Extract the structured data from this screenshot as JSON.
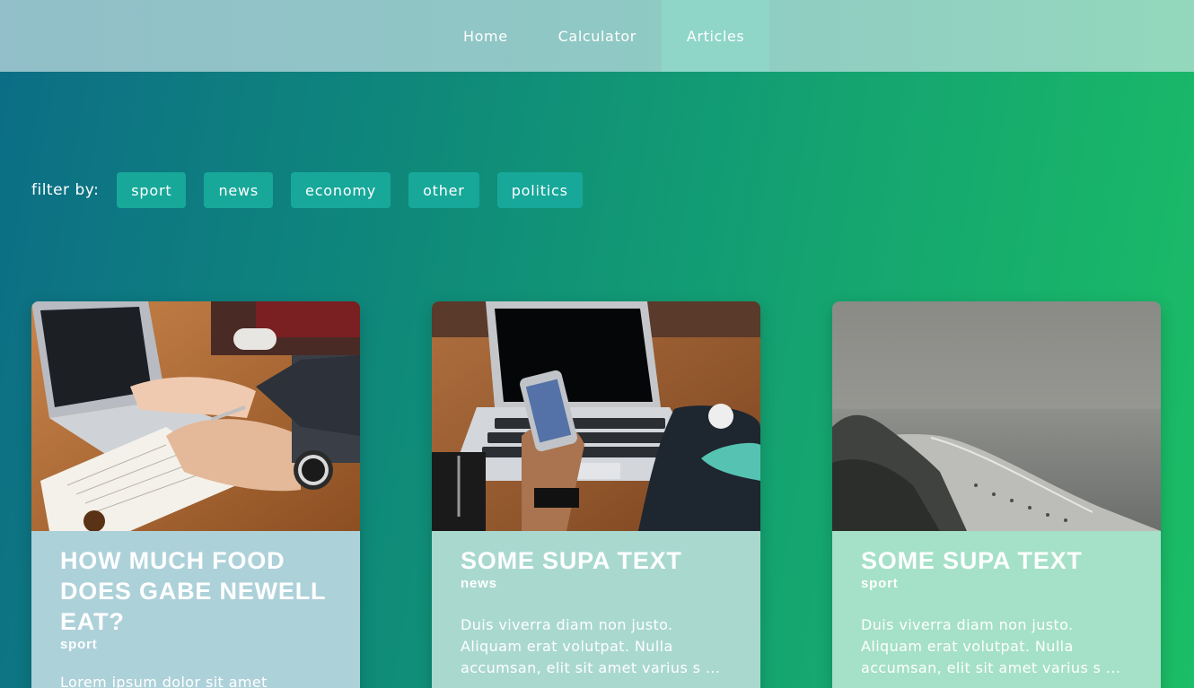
{
  "nav": {
    "items": [
      {
        "label": "Home",
        "active": false
      },
      {
        "label": "Calculator",
        "active": false
      },
      {
        "label": "Articles",
        "active": true
      }
    ]
  },
  "filter": {
    "label": "filter by:",
    "options": [
      "sport",
      "news",
      "economy",
      "other",
      "politics"
    ]
  },
  "articles": [
    {
      "title": "HOW MUCH FOOD DOES GABE NEWELL EAT?",
      "category": "sport",
      "excerpt": "Lorem ipsum dolor sit amet",
      "image": "laptop-notebook-writing-photo"
    },
    {
      "title": "SOME SUPA TEXT",
      "category": "news",
      "excerpt": "Duis viverra diam non justo. Aliquam erat volutpat. Nulla accumsan, elit sit amet varius s ...",
      "image": "laptop-phone-photo"
    },
    {
      "title": "SOME SUPA TEXT",
      "category": "sport",
      "excerpt": "Duis viverra diam non justo. Aliquam erat volutpat. Nulla accumsan, elit sit amet varius s ...",
      "image": "foggy-beach-coast-photo"
    }
  ],
  "colors": {
    "card_body_1": "#add1d9",
    "card_body_2": "#a9d8cf",
    "card_body_3": "#a5e0c8",
    "chip": "#17a89a"
  }
}
